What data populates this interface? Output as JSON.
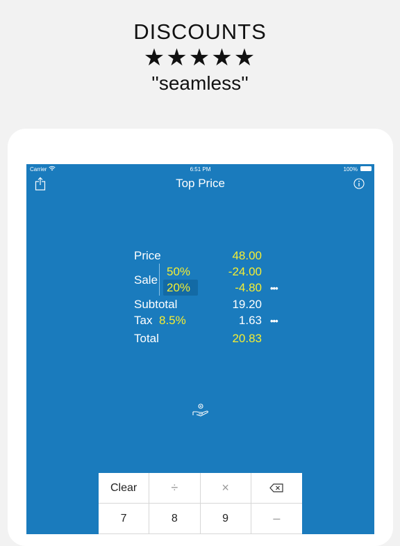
{
  "promo": {
    "headline": "DISCOUNTS",
    "stars": "★★★★★",
    "quote": "''seamless''"
  },
  "status_bar": {
    "carrier": "Carrier",
    "time": "6:51 PM",
    "battery": "100%"
  },
  "nav": {
    "title": "Top Price",
    "share_icon": "share-icon",
    "info_icon": "info-icon"
  },
  "calculation": {
    "price": {
      "label": "Price",
      "value": "48.00"
    },
    "sale": {
      "label": "Sale",
      "discounts": [
        {
          "percent": "50%",
          "amount": "-24.00"
        },
        {
          "percent": "20%",
          "amount": "-4.80"
        }
      ]
    },
    "subtotal": {
      "label": "Subtotal",
      "value": "19.20"
    },
    "tax": {
      "label": "Tax",
      "rate": "8.5%",
      "value": "1.63"
    },
    "total": {
      "label": "Total",
      "value": "20.83"
    },
    "more_symbol": "•••"
  },
  "keypad": {
    "keys": [
      "Clear",
      "÷",
      "×",
      "⌫",
      "7",
      "8",
      "9",
      "–"
    ]
  },
  "colors": {
    "screen_bg": "#1a7bbd",
    "highlight": "#f5ee33",
    "page_bg": "#f2f2f2"
  }
}
